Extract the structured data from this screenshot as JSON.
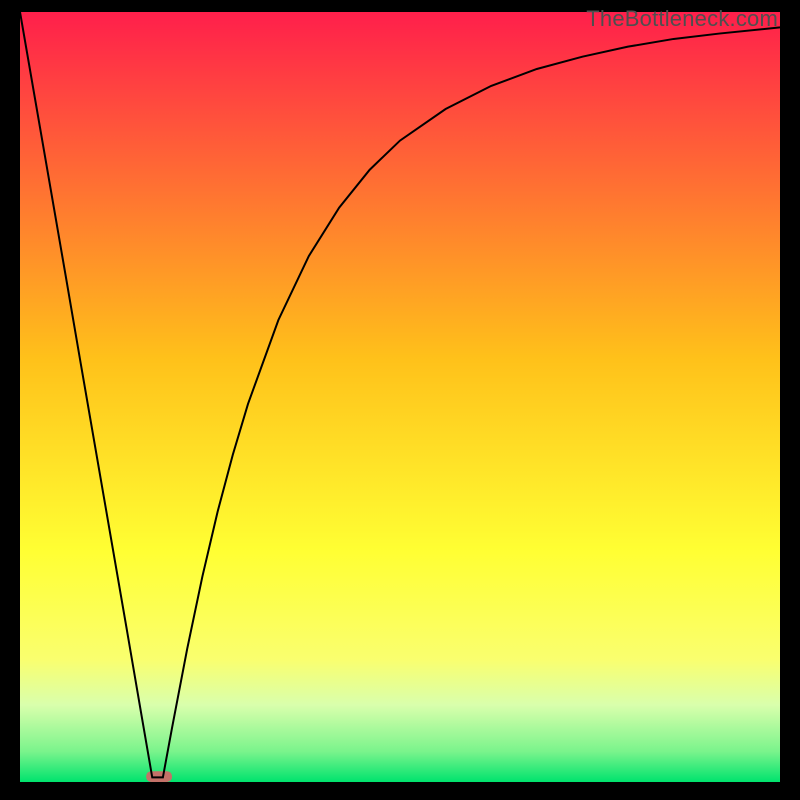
{
  "watermark": "TheBottleneck.com",
  "chart_data": {
    "type": "line",
    "title": "",
    "xlabel": "",
    "ylabel": "",
    "xlim": [
      0,
      100
    ],
    "ylim": [
      0,
      100
    ],
    "series": [
      {
        "name": "heat-gradient",
        "type": "background",
        "stops": [
          {
            "pos": 0.0,
            "color": "#ff1f4b"
          },
          {
            "pos": 0.45,
            "color": "#ffc11a"
          },
          {
            "pos": 0.7,
            "color": "#ffff33"
          },
          {
            "pos": 0.84,
            "color": "#faff6e"
          },
          {
            "pos": 0.9,
            "color": "#d9ffac"
          },
          {
            "pos": 0.96,
            "color": "#7bf48c"
          },
          {
            "pos": 1.0,
            "color": "#00e36e"
          }
        ]
      },
      {
        "name": "curve",
        "type": "line",
        "color": "#000000",
        "x": [
          0.0,
          2.0,
          4.0,
          6.0,
          8.0,
          10.0,
          12.0,
          14.0,
          16.0,
          17.4,
          18.0,
          18.8,
          20.0,
          22.0,
          24.0,
          26.0,
          28.0,
          30.0,
          34.0,
          38.0,
          42.0,
          46.0,
          50.0,
          56.0,
          62.0,
          68.0,
          74.0,
          80.0,
          86.0,
          92.0,
          100.0
        ],
        "y": [
          100.0,
          88.6,
          77.2,
          65.8,
          54.3,
          42.9,
          31.5,
          20.1,
          8.6,
          0.6,
          0.6,
          0.6,
          7.0,
          17.3,
          26.7,
          35.1,
          42.5,
          49.1,
          60.0,
          68.3,
          74.6,
          79.5,
          83.3,
          87.4,
          90.4,
          92.6,
          94.2,
          95.5,
          96.5,
          97.2,
          98.0
        ]
      },
      {
        "name": "marker",
        "type": "pill",
        "color": "#c47168",
        "x0": 16.6,
        "x1": 20.0,
        "y": 0.0,
        "height_pct": 1.4
      }
    ]
  }
}
